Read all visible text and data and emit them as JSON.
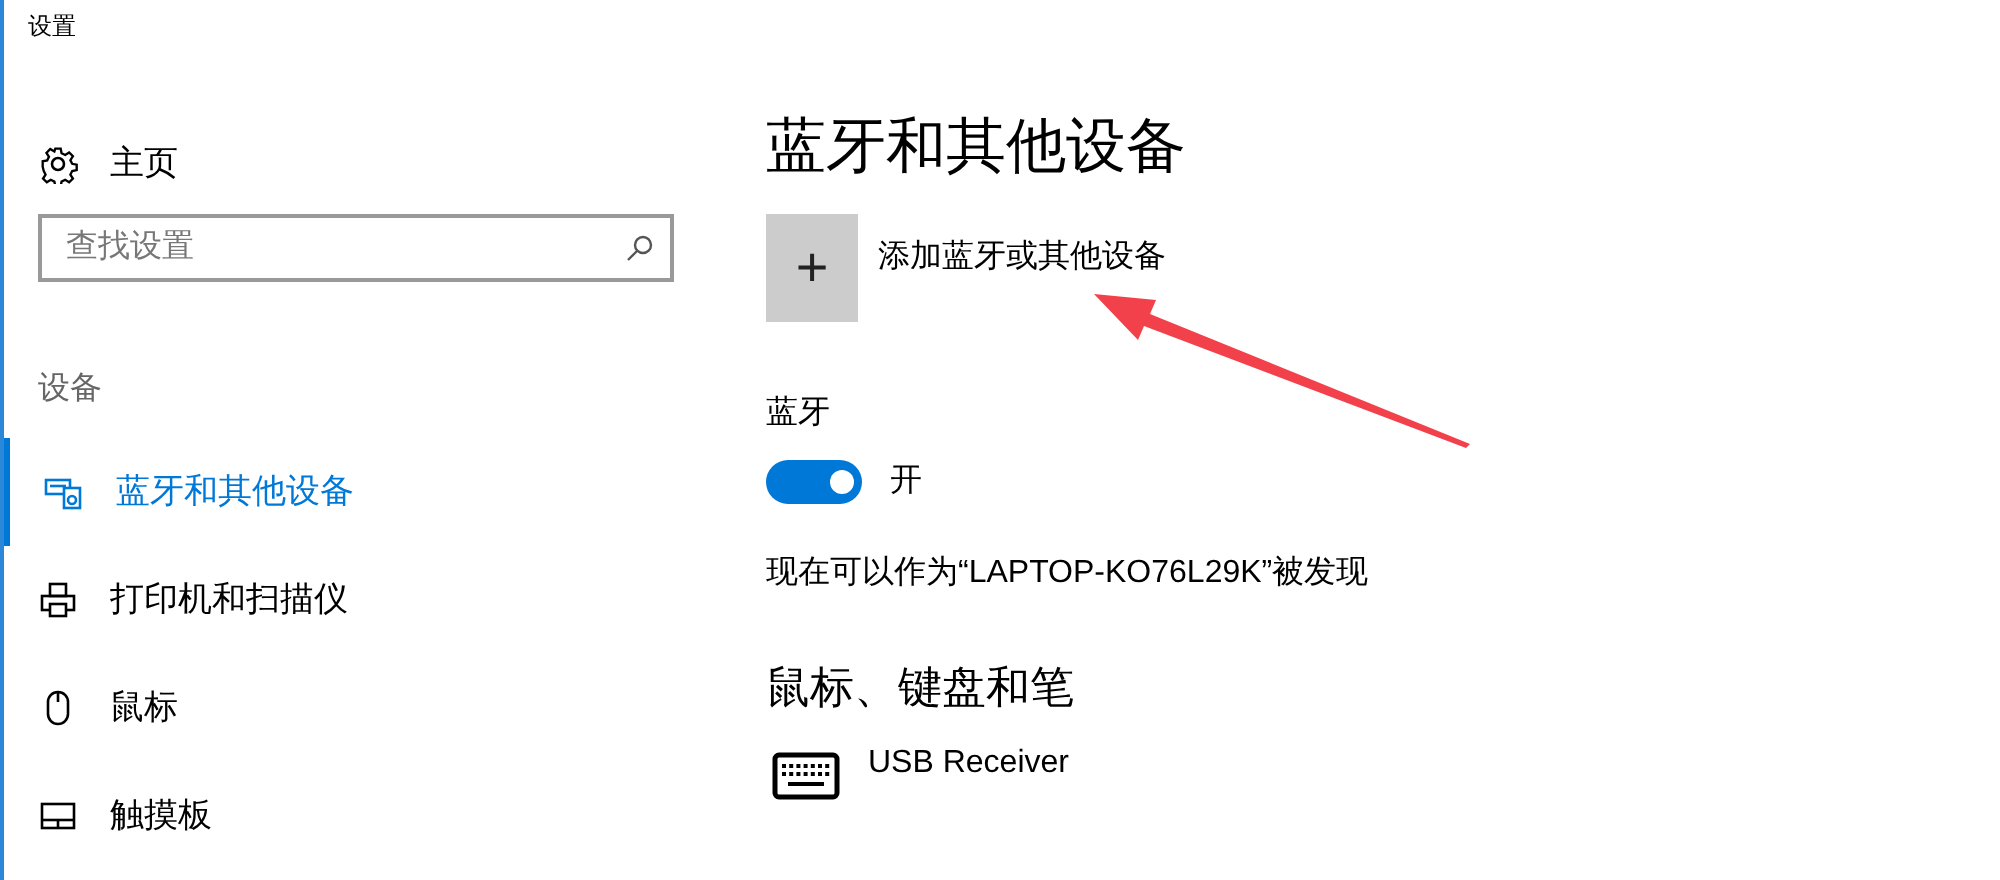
{
  "window": {
    "title": "设置"
  },
  "sidebar": {
    "home": "主页",
    "search": {
      "placeholder": "查找设置"
    },
    "section": "设备",
    "items": [
      {
        "label": "蓝牙和其他设备",
        "selected": true
      },
      {
        "label": "打印机和扫描仪",
        "selected": false
      },
      {
        "label": "鼠标",
        "selected": false
      },
      {
        "label": "触摸板",
        "selected": false
      }
    ]
  },
  "main": {
    "title": "蓝牙和其他设备",
    "add_button": {
      "icon": "+",
      "label": "添加蓝牙或其他设备"
    },
    "bluetooth": {
      "label": "蓝牙",
      "on": true,
      "state_text": "开"
    },
    "discoverable": "现在可以作为“LAPTOP-KO76L29K”被发现",
    "section": "鼠标、键盘和笔",
    "devices": [
      {
        "name": "USB Receiver"
      }
    ]
  }
}
